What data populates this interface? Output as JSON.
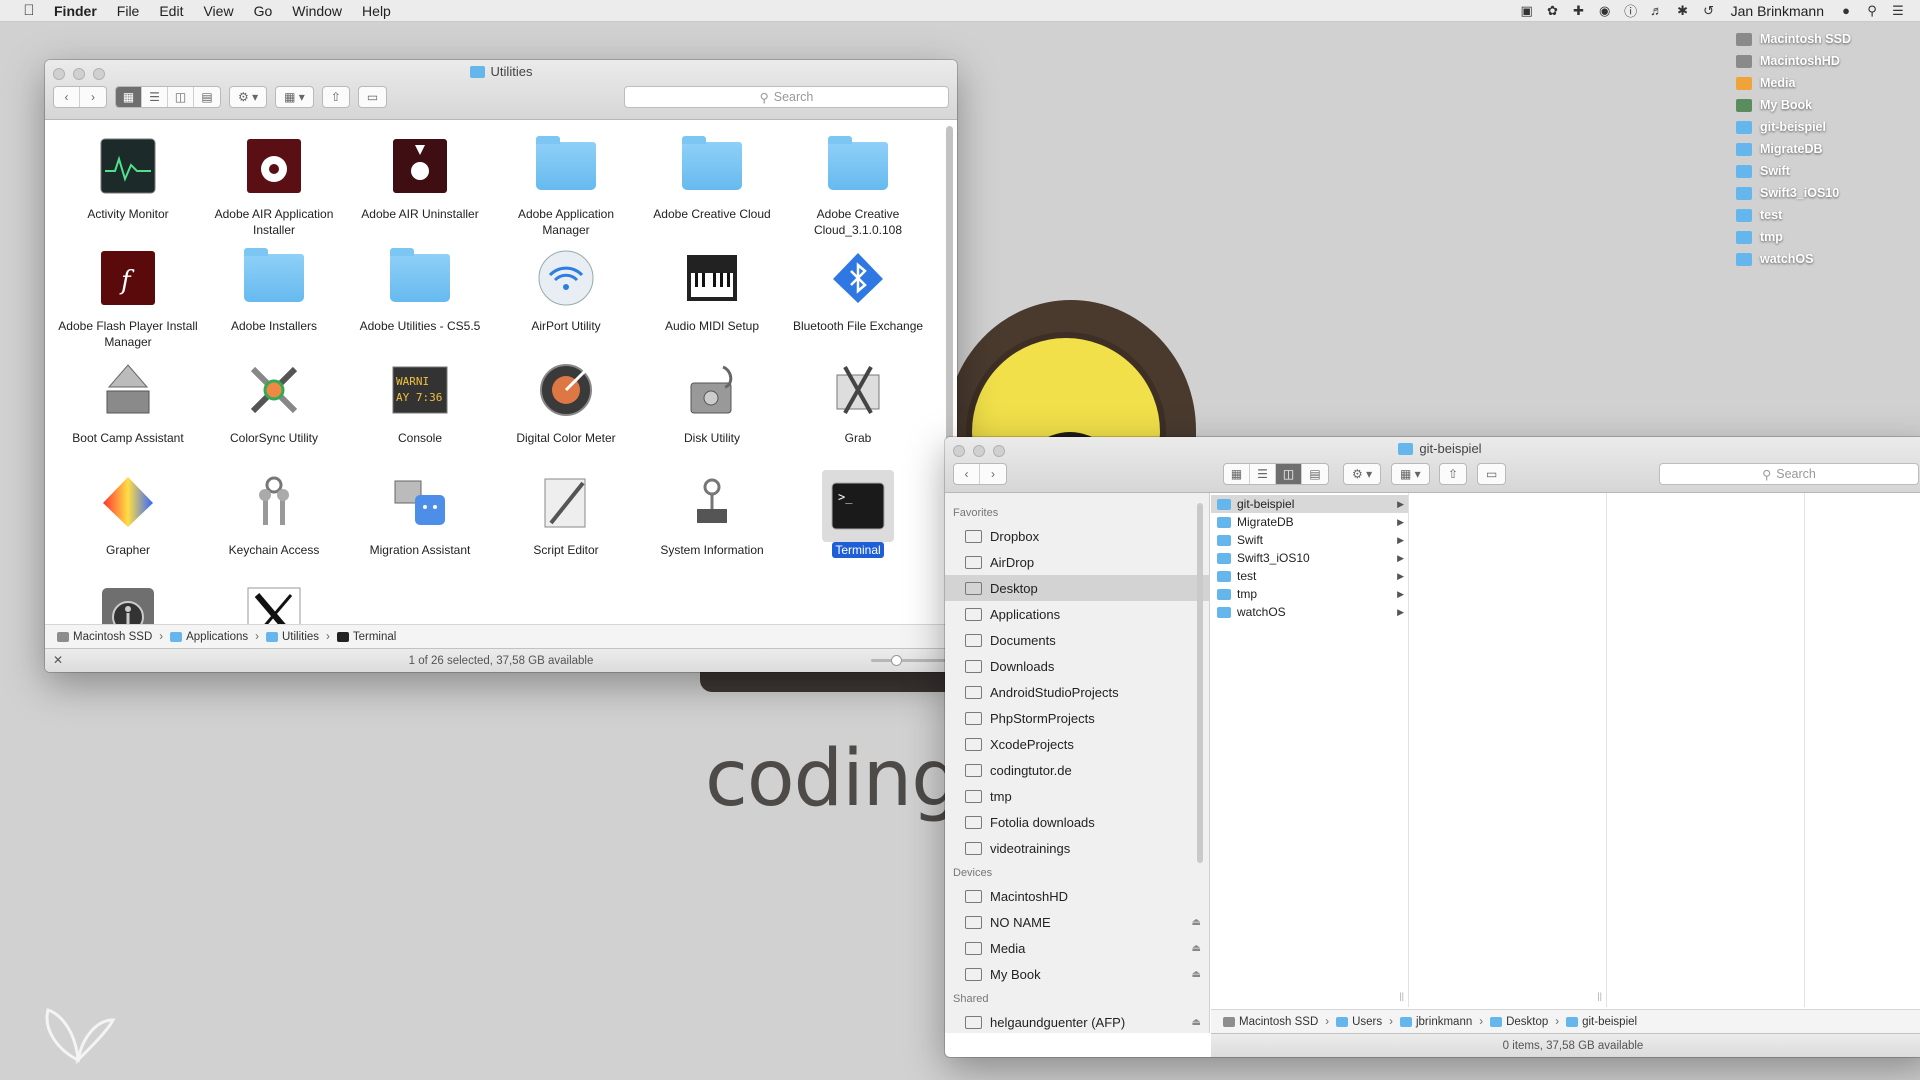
{
  "menubar": {
    "app": "Finder",
    "items": [
      "File",
      "Edit",
      "View",
      "Go",
      "Window",
      "Help"
    ],
    "user": "Jan Brinkmann"
  },
  "desktop": {
    "brand_text": "coding",
    "items": [
      {
        "label": "Macintosh SSD",
        "kind": "drive"
      },
      {
        "label": "MacintoshHD",
        "kind": "drive"
      },
      {
        "label": "Media",
        "kind": "media"
      },
      {
        "label": "My Book",
        "kind": "book"
      },
      {
        "label": "git-beispiel",
        "kind": "folder"
      },
      {
        "label": "MigrateDB",
        "kind": "folder"
      },
      {
        "label": "Swift",
        "kind": "folder"
      },
      {
        "label": "Swift3_iOS10",
        "kind": "folder"
      },
      {
        "label": "test",
        "kind": "folder"
      },
      {
        "label": "tmp",
        "kind": "folder"
      },
      {
        "label": "watchOS",
        "kind": "folder"
      }
    ]
  },
  "utilities": {
    "title": "Utilities",
    "search_placeholder": "Search",
    "icons": [
      {
        "label": "Activity Monitor",
        "icon": "activity-monitor-icon"
      },
      {
        "label": "Adobe AIR Application Installer",
        "icon": "adobe-air-icon"
      },
      {
        "label": "Adobe AIR Uninstaller",
        "icon": "adobe-air-uninstall-icon"
      },
      {
        "label": "Adobe Application Manager",
        "icon": "folder-icon"
      },
      {
        "label": "Adobe Creative Cloud",
        "icon": "folder-icon"
      },
      {
        "label": "Adobe Creative Cloud_3.1.0.108",
        "icon": "folder-icon"
      },
      {
        "label": "Adobe Flash Player Install Manager",
        "icon": "flash-player-icon"
      },
      {
        "label": "Adobe Installers",
        "icon": "folder-icon"
      },
      {
        "label": "Adobe Utilities - CS5.5",
        "icon": "folder-icon"
      },
      {
        "label": "AirPort Utility",
        "icon": "airport-icon"
      },
      {
        "label": "Audio MIDI Setup",
        "icon": "midi-keyboard-icon"
      },
      {
        "label": "Bluetooth File Exchange",
        "icon": "bluetooth-icon"
      },
      {
        "label": "Boot Camp Assistant",
        "icon": "boot-camp-icon"
      },
      {
        "label": "ColorSync Utility",
        "icon": "colorsync-icon"
      },
      {
        "label": "Console",
        "icon": "console-icon"
      },
      {
        "label": "Digital Color Meter",
        "icon": "color-meter-icon"
      },
      {
        "label": "Disk Utility",
        "icon": "disk-utility-icon"
      },
      {
        "label": "Grab",
        "icon": "grab-icon"
      },
      {
        "label": "Grapher",
        "icon": "grapher-icon"
      },
      {
        "label": "Keychain Access",
        "icon": "keychain-icon"
      },
      {
        "label": "Migration Assistant",
        "icon": "migration-icon"
      },
      {
        "label": "Script Editor",
        "icon": "script-editor-icon"
      },
      {
        "label": "System Information",
        "icon": "system-info-icon"
      },
      {
        "label": "Terminal",
        "icon": "terminal-icon",
        "selected": true
      },
      {
        "label": "",
        "icon": "voiceover-icon"
      },
      {
        "label": "",
        "icon": "x11-icon"
      }
    ],
    "console_text": "WARNI AY 7:36",
    "path": [
      "Macintosh SSD",
      "Applications",
      "Utilities",
      "Terminal"
    ],
    "status": "1 of 26 selected, 37,58 GB available"
  },
  "git": {
    "title": "git-beispiel",
    "search_placeholder": "Search",
    "favorites_label": "Favorites",
    "devices_label": "Devices",
    "shared_label": "Shared",
    "favorites": [
      "Dropbox",
      "AirDrop",
      "Desktop",
      "Applications",
      "Documents",
      "Downloads",
      "AndroidStudioProjects",
      "PhpStormProjects",
      "XcodeProjects",
      "codingtutor.de",
      "tmp",
      "Fotolia downloads",
      "videotrainings"
    ],
    "devices": [
      "MacintoshHD",
      "NO NAME",
      "Media",
      "My Book"
    ],
    "shared": [
      "helgaundguenter (AFP)"
    ],
    "column_items": [
      "git-beispiel",
      "MigrateDB",
      "Swift",
      "Swift3_iOS10",
      "test",
      "tmp",
      "watchOS"
    ],
    "path": [
      "Macintosh SSD",
      "Users",
      "jbrinkmann",
      "Desktop",
      "git-beispiel"
    ],
    "status": "0 items, 37,58 GB available"
  }
}
